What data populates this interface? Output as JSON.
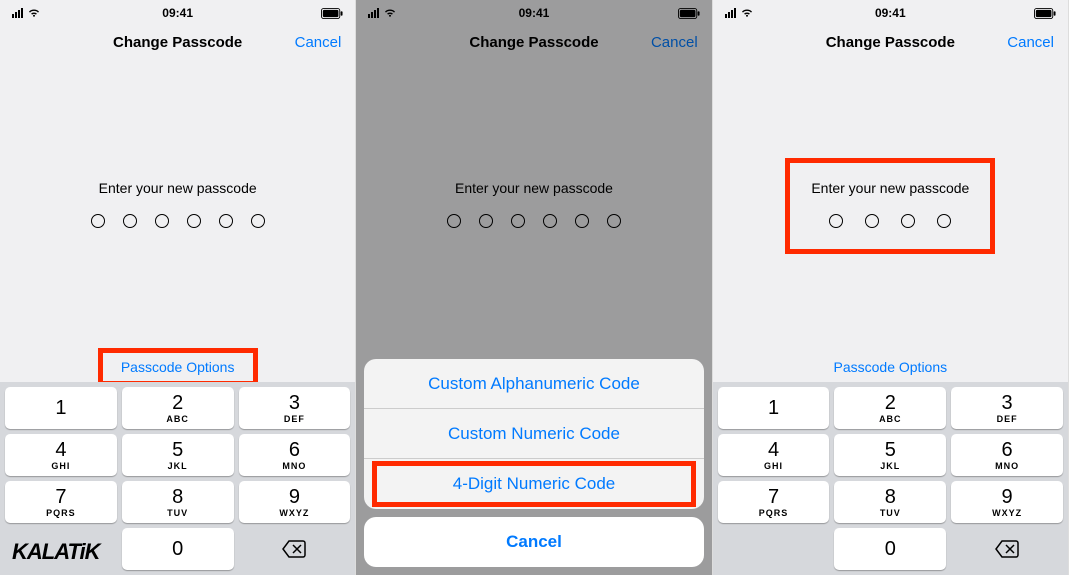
{
  "status": {
    "time": "09:41"
  },
  "nav": {
    "title": "Change Passcode",
    "cancel": "Cancel"
  },
  "prompt": "Enter your new passcode",
  "options_link": "Passcode Options",
  "keypad": {
    "keys": [
      {
        "num": "1",
        "letters": ""
      },
      {
        "num": "2",
        "letters": "ABC"
      },
      {
        "num": "3",
        "letters": "DEF"
      },
      {
        "num": "4",
        "letters": "GHI"
      },
      {
        "num": "5",
        "letters": "JKL"
      },
      {
        "num": "6",
        "letters": "MNO"
      },
      {
        "num": "7",
        "letters": "PQRS"
      },
      {
        "num": "8",
        "letters": "TUV"
      },
      {
        "num": "9",
        "letters": "WXYZ"
      },
      {
        "num": "0",
        "letters": ""
      }
    ]
  },
  "sheet": {
    "items": [
      "Custom Alphanumeric Code",
      "Custom Numeric Code",
      "4-Digit Numeric Code"
    ],
    "cancel": "Cancel"
  },
  "watermark": "KALATiK"
}
